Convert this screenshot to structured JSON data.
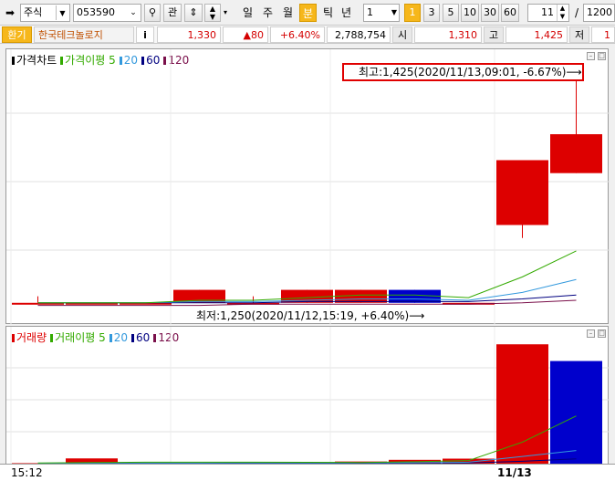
{
  "toolbar": {
    "market_select": "주식",
    "code_input": "053590",
    "btn_relation": "관",
    "periods": [
      "일",
      "주",
      "월",
      "분",
      "틱",
      "년"
    ],
    "active_period": "분",
    "interval_select": "1",
    "intervals": [
      "1",
      "3",
      "5",
      "10",
      "30",
      "60"
    ],
    "active_interval": "1",
    "count_value": "11",
    "slash": "/",
    "total_value": "1200"
  },
  "infobar": {
    "tag": "환기",
    "stock_name": "한국테크놀로지",
    "info_btn": "i",
    "price": "1,330",
    "change": "▲80",
    "change_rate": "+6.40%",
    "volume": "2,788,754",
    "open_label": "시",
    "open_value": "1,310",
    "high_label": "고",
    "high_value": "1,425",
    "low_label": "저",
    "low_value": "1"
  },
  "price_pane": {
    "legend": [
      "가격차트",
      "가격이평 5",
      "20",
      "60",
      "120"
    ],
    "high_annotation": "최고:1,425(2020/11/13,09:01, -6.67%)⟶",
    "low_annotation": "최저:1,250(2020/11/12,15:19, +6.40%)⟶"
  },
  "volume_pane": {
    "legend": [
      "거래량",
      "거래이평 5",
      "20",
      "60",
      "120"
    ]
  },
  "time_axis": {
    "left_label": "15:12",
    "date_label": "11/13"
  },
  "colors": {
    "up": "#dd0000",
    "down": "#0000cc",
    "ma5": "#33aa00",
    "ma20": "#3399dd",
    "ma60": "#000080",
    "ma120": "#7a0f4a",
    "price_line": "#000000"
  },
  "chart_data": {
    "type": "candlestick",
    "price": {
      "ohlc": [
        {
          "o": 1250,
          "h": 1255,
          "l": 1250,
          "c": 1250
        },
        {
          "o": 1250,
          "h": 1250,
          "l": 1250,
          "c": 1250
        },
        {
          "o": 1250,
          "h": 1250,
          "l": 1250,
          "c": 1250
        },
        {
          "o": 1250,
          "h": 1260,
          "l": 1250,
          "c": 1260
        },
        {
          "o": 1250,
          "h": 1255,
          "l": 1250,
          "c": 1250
        },
        {
          "o": 1250,
          "h": 1260,
          "l": 1250,
          "c": 1260
        },
        {
          "o": 1250,
          "h": 1260,
          "l": 1250,
          "c": 1260
        },
        {
          "o": 1260,
          "h": 1260,
          "l": 1250,
          "c": 1250
        },
        {
          "o": 1250,
          "h": 1250,
          "l": 1250,
          "c": 1250
        },
        {
          "o": 1310,
          "h": 1360,
          "l": 1300,
          "c": 1360
        },
        {
          "o": 1350,
          "h": 1425,
          "l": 1350,
          "c": 1380
        }
      ],
      "ma5": [
        1250,
        1250,
        1250,
        1252,
        1252,
        1254,
        1256,
        1256,
        1254,
        1270,
        1290
      ],
      "ma20": [
        1250,
        1250,
        1250,
        1251,
        1251,
        1252,
        1253,
        1253,
        1252,
        1258,
        1268
      ],
      "ma60": [
        1250,
        1250,
        1250,
        1250,
        1250,
        1251,
        1251,
        1251,
        1251,
        1253,
        1256
      ],
      "ma120": [
        1248,
        1248,
        1248,
        1248,
        1249,
        1249,
        1249,
        1249,
        1249,
        1250,
        1252
      ]
    },
    "volume": {
      "values": [
        2000,
        22000,
        1000,
        1500,
        2500,
        2000,
        9000,
        16000,
        21000,
        500000,
        430000
      ],
      "up": [
        true,
        true,
        true,
        true,
        true,
        true,
        true,
        true,
        true,
        true,
        false
      ],
      "ma5": [
        3000,
        5000,
        6000,
        6000,
        6000,
        5500,
        5000,
        8000,
        13000,
        90000,
        200000
      ],
      "ma20": [
        2000,
        2500,
        3000,
        3000,
        3200,
        3300,
        3500,
        4500,
        6000,
        30000,
        55000
      ],
      "ma60": [
        1500,
        1600,
        1700,
        1800,
        1900,
        2000,
        2100,
        2400,
        2800,
        10000,
        20000
      ]
    }
  }
}
